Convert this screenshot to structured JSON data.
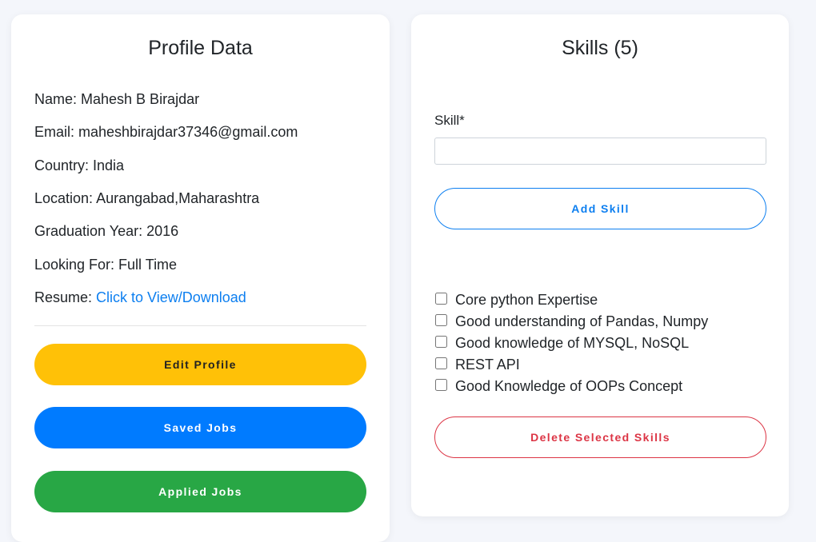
{
  "profile": {
    "title": "Profile Data",
    "name_line": "Name: Mahesh B Birajdar",
    "email_line": "Email: maheshbirajdar37346@gmail.com",
    "country_line": "Country: India",
    "location_line": "Location: Aurangabad,Maharashtra",
    "graduation_line": "Graduation Year: 2016",
    "looking_for_line": "Looking For: Full Time",
    "resume_label": "Resume: ",
    "resume_link": "Click to View/Download",
    "edit_profile_label": "Edit Profile",
    "saved_jobs_label": "Saved Jobs",
    "applied_jobs_label": "Applied Jobs"
  },
  "skills": {
    "title": "Skills (5)",
    "input_label": "Skill*",
    "input_value": "",
    "add_button_label": "Add Skill",
    "items": [
      {
        "label": "Core python Expertise",
        "checked": false
      },
      {
        "label": "Good understanding of Pandas, Numpy",
        "checked": false
      },
      {
        "label": "Good knowledge of MYSQL, NoSQL",
        "checked": false
      },
      {
        "label": "REST API",
        "checked": false
      },
      {
        "label": "Good Knowledge of OOPs Concept",
        "checked": false
      }
    ],
    "delete_button_label": "Delete Selected Skills"
  },
  "colors": {
    "edit_button": "#ffc107",
    "saved_jobs_button": "#007bff",
    "applied_jobs_button": "#28a745",
    "link": "#0d7ff0",
    "delete_outline": "#dc3545"
  }
}
